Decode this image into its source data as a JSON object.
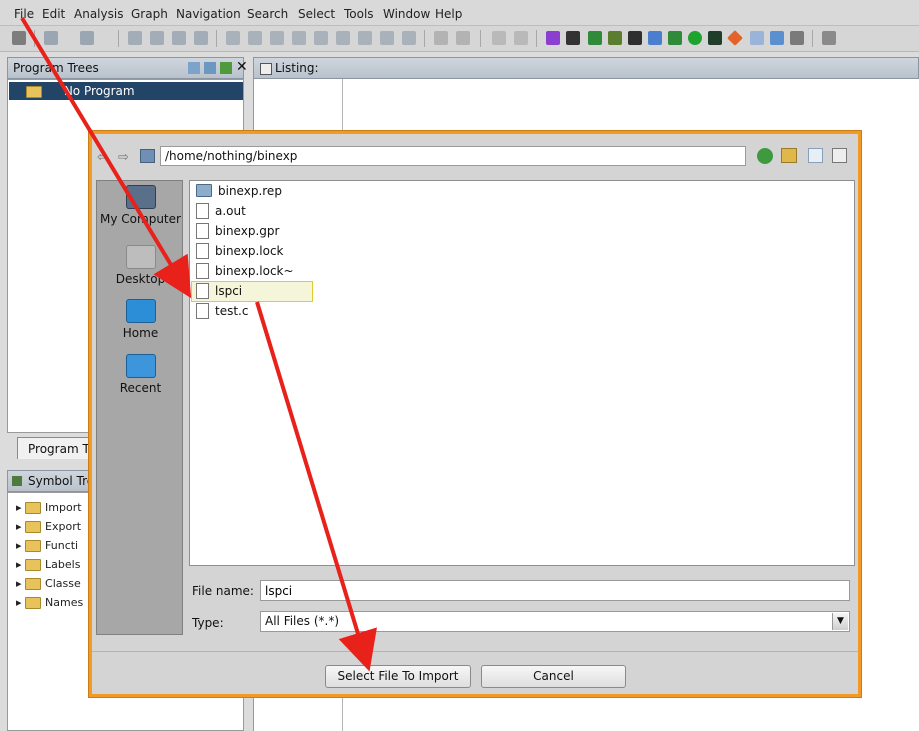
{
  "menubar": {
    "items": [
      "File",
      "Edit",
      "Analysis",
      "Graph",
      "Navigation",
      "Search",
      "Select",
      "Tools",
      "Window",
      "Help"
    ]
  },
  "left_panels": {
    "program_trees": {
      "title": "Program Trees",
      "row": "No Program",
      "tab": "Program T"
    },
    "symbol_tree": {
      "title": "Symbol Tre",
      "items": [
        "Import",
        "Export",
        "Functi",
        "Labels",
        "Classe",
        "Names"
      ]
    }
  },
  "listing": {
    "title": "Listing:"
  },
  "dialog": {
    "path": "/home/nothing/binexp",
    "places": [
      {
        "label": "My Computer",
        "icon": "computer-icon"
      },
      {
        "label": "Desktop",
        "icon": "desktop-icon"
      },
      {
        "label": "Home",
        "icon": "home-icon"
      },
      {
        "label": "Recent",
        "icon": "recent-icon"
      }
    ],
    "files": [
      {
        "name": "binexp.rep",
        "type": "folder"
      },
      {
        "name": "a.out",
        "type": "file"
      },
      {
        "name": "binexp.gpr",
        "type": "file"
      },
      {
        "name": "binexp.lock",
        "type": "file"
      },
      {
        "name": "binexp.lock~",
        "type": "file"
      },
      {
        "name": "lspci",
        "type": "file",
        "selected": true
      },
      {
        "name": "test.c",
        "type": "file"
      }
    ],
    "file_name_label": "File name:",
    "file_name_value": "lspci",
    "type_label": "Type:",
    "type_value": "All Files (*.*)",
    "select_button": "Select File To Import",
    "cancel_button": "Cancel"
  },
  "colors": {
    "dialog_border": "#f29a25",
    "arrow": "#e8211b",
    "selected_row": "#224466"
  }
}
